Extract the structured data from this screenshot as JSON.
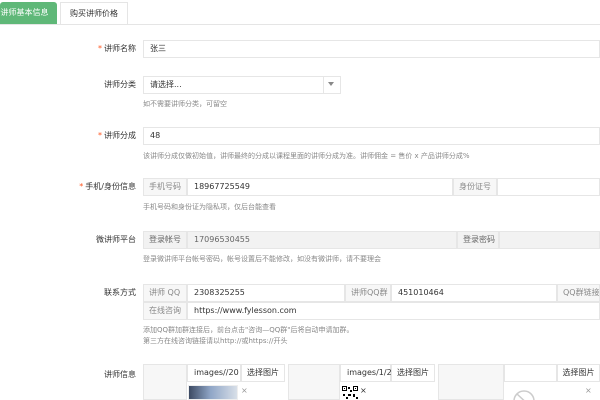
{
  "tabs": {
    "basic": "讲师基本信息",
    "price": "购买讲师价格"
  },
  "name": {
    "label": "讲师名称",
    "value": "张三"
  },
  "category": {
    "label": "讲师分类",
    "selected": "请选择...",
    "hint": "如不需要讲师分类，可留空"
  },
  "share": {
    "label": "讲师分成",
    "value": "48",
    "hint": "该讲师分成仅做初始值，讲师最终的分成以课程里面的讲师分成为准。讲师佣金 = 售价 x 产品讲师分成%"
  },
  "phone": {
    "label": "手机/身份信息",
    "phone_addon": "手机号码",
    "phone_value": "18967725549",
    "id_addon": "身份证号",
    "hint": "手机号码和身份证为隐私项，仅后台能查看"
  },
  "micro": {
    "label": "微讲师平台",
    "account_addon": "登录帐号",
    "account_value": "17096530455",
    "password_addon": "登录密码",
    "hint": "登录微讲师平台帐号密码，帐号设置后不能修改，如没有微讲师，请不要理会"
  },
  "contact": {
    "label": "联系方式",
    "qq_addon": "讲师 QQ",
    "qq_value": "2308325255",
    "group_addon": "讲师QQ群",
    "group_value": "451010464",
    "group_link_addon": "QQ群链接",
    "consult_addon": "在线咨询",
    "consult_value": "https://www.fylesson.com",
    "hint_line1": "添加QQ群加群连接后，前台点击\"咨询—QQ群\"后将自动申请加群。",
    "hint_line2": "第三方在线咨询链接请以http://或https://开头"
  },
  "teacher_info": {
    "label": "讲师信息",
    "path1": "images//20",
    "btn1": "选择图片",
    "path2": "images/1/2",
    "btn2": "选择图片",
    "btn3": "选择图片",
    "close": "×"
  }
}
